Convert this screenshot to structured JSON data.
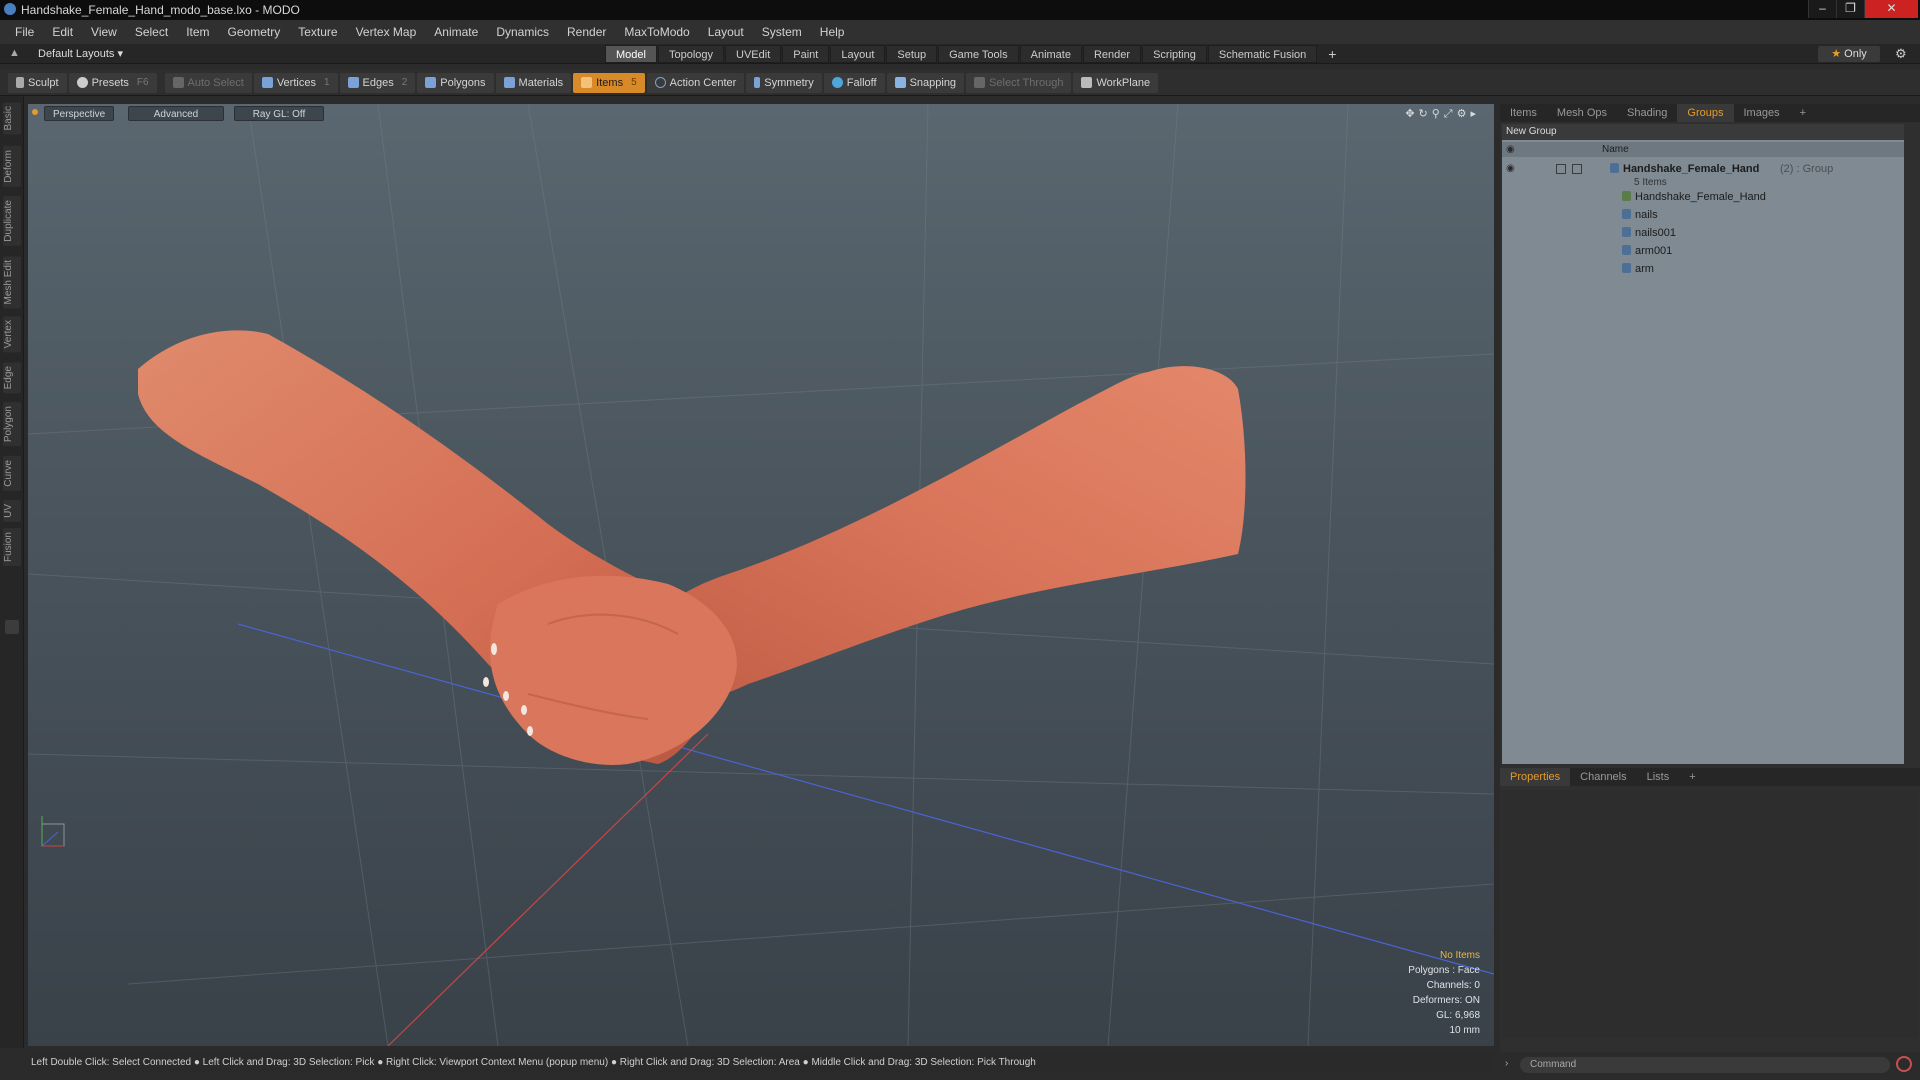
{
  "window": {
    "title": "Handshake_Female_Hand_modo_base.lxo - MODO",
    "controls": [
      "–",
      "❐",
      "✕"
    ]
  },
  "menu": [
    "File",
    "Edit",
    "View",
    "Select",
    "Item",
    "Geometry",
    "Texture",
    "Vertex Map",
    "Animate",
    "Dynamics",
    "Render",
    "MaxToModo",
    "Layout",
    "System",
    "Help"
  ],
  "layout_bar": {
    "layout_select": "Default Layouts ▾",
    "tabs": [
      "Model",
      "Topology",
      "UVEdit",
      "Paint",
      "Layout",
      "Setup",
      "Game Tools",
      "Animate",
      "Render",
      "Scripting",
      "Schematic Fusion"
    ],
    "active_tab": "Model",
    "only_label": "Only"
  },
  "toolbar": {
    "sculpt": "Sculpt",
    "presets": "Presets",
    "presets_key": "F6",
    "auto_select": "Auto Select",
    "vertices": "Vertices",
    "vertices_count": "1",
    "edges": "Edges",
    "edges_count": "2",
    "polygons": "Polygons",
    "materials": "Materials",
    "items": "Items",
    "items_count": "5",
    "action_center": "Action Center",
    "symmetry": "Symmetry",
    "falloff": "Falloff",
    "snapping": "Snapping",
    "select_through": "Select Through",
    "workplane": "WorkPlane"
  },
  "left_tabs": [
    "Basic",
    "Deform",
    "Duplicate",
    "Mesh Edit",
    "Vertex",
    "Edge",
    "Polygon",
    "Curve",
    "UV",
    "Fusion"
  ],
  "viewport": {
    "perspective": "Perspective",
    "advanced": "Advanced",
    "raygl": "Ray GL: Off",
    "info": {
      "no_items": "No Items",
      "polygons": "Polygons : Face",
      "channels": "Channels: 0",
      "deformers": "Deformers: ON",
      "gl": "GL: 6,968",
      "scale": "10 mm"
    }
  },
  "status_bar": "Left Double Click: Select Connected ● Left Click and Drag: 3D Selection: Pick ● Right Click: Viewport Context Menu (popup menu) ● Right Click and Drag: 3D Selection: Area ● Middle Click and Drag: 3D Selection: Pick Through",
  "right_panel": {
    "top_tabs": [
      "Items",
      "Mesh Ops",
      "Shading",
      "Groups",
      "Images"
    ],
    "active_top_tab": "Groups",
    "new_group": "New Group",
    "col_name": "Name",
    "group_name": "Handshake_Female_Hand",
    "group_suffix": "(2) : Group",
    "group_count": "5 Items",
    "items": [
      "Handshake_Female_Hand",
      "nails",
      "nails001",
      "arm001",
      "arm"
    ],
    "bottom_tabs": [
      "Properties",
      "Channels",
      "Lists"
    ],
    "active_bottom_tab": "Properties",
    "command_placeholder": "Command"
  },
  "colors": {
    "accent": "#e39b2c",
    "skin": "#d9795c",
    "viewport_top": "#5a6770",
    "viewport_bottom": "#394149"
  }
}
